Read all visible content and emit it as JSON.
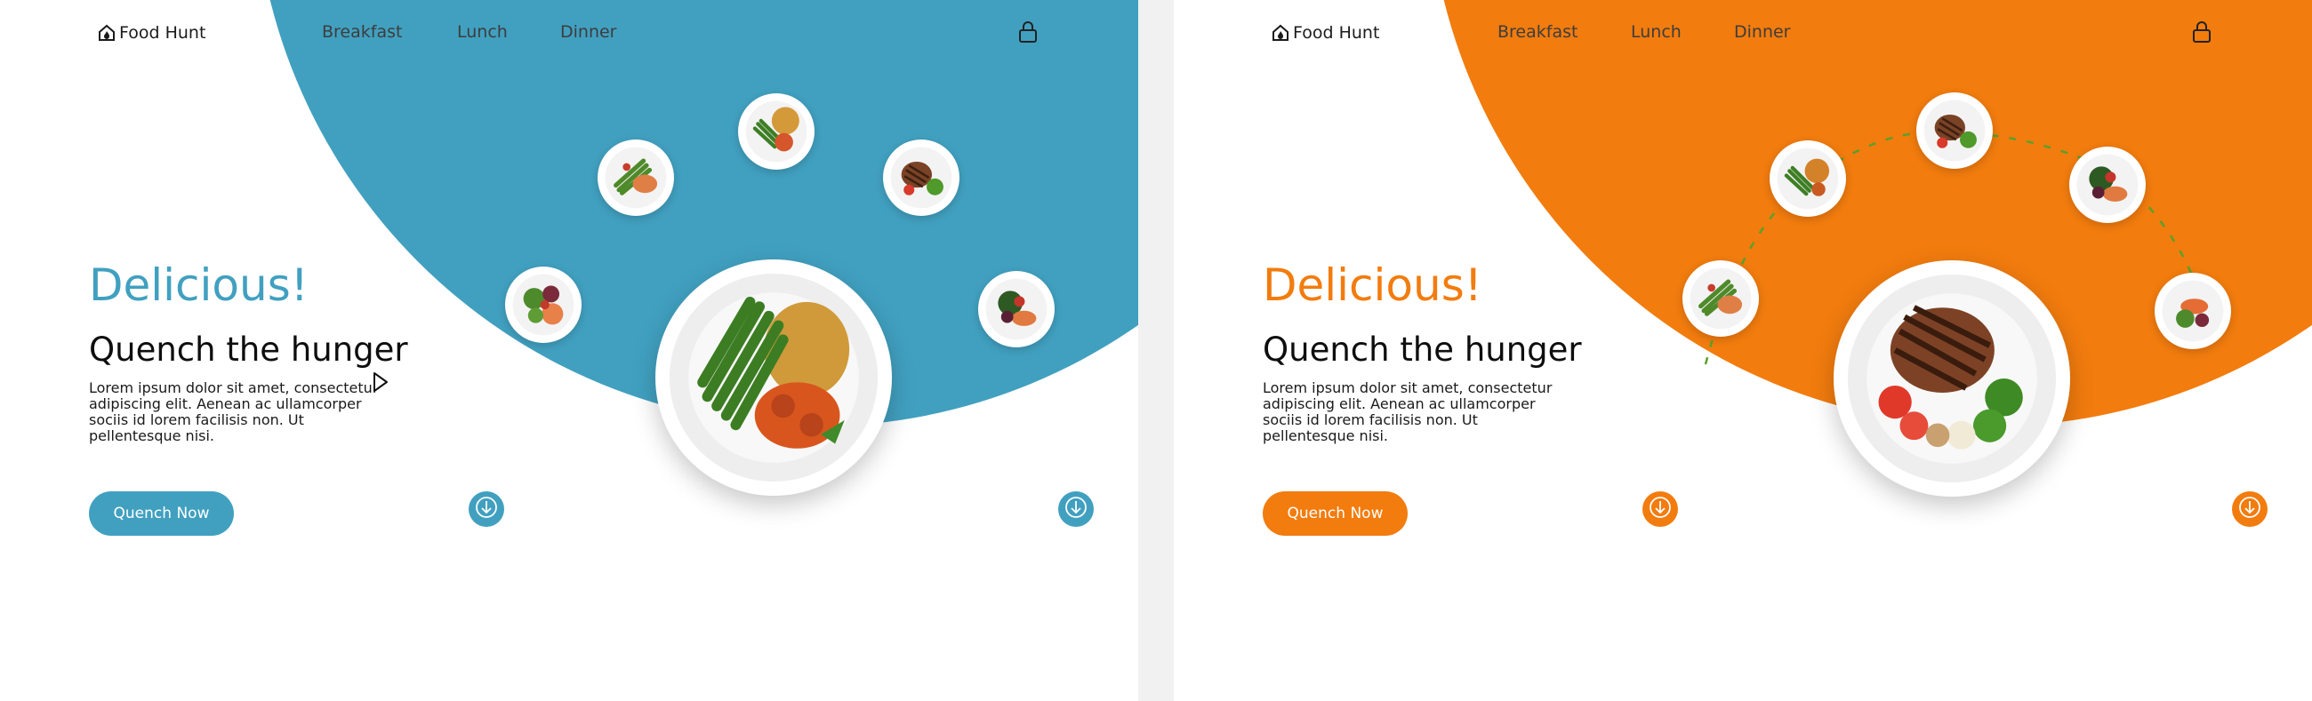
{
  "panels": [
    {
      "theme": "blue",
      "accent": "#41a0c0",
      "brand": {
        "name": "Food Hunt",
        "icon": "home-flame-icon"
      },
      "nav": [
        {
          "label": "Breakfast"
        },
        {
          "label": "Lunch"
        },
        {
          "label": "Dinner"
        }
      ],
      "lock_icon": "lock-icon",
      "hero": {
        "accent_text": "Delicious!",
        "title": "Quench the hunger",
        "body": "Lorem ipsum dolor sit amet, consectetur adipiscing elit. Aenean ac ullamcorper sociis id lorem facilisis non. Ut pellentesque nisi.",
        "cta": "Quench Now"
      },
      "featured_dish": "green beans, rice and glazed chicken",
      "carousel": [
        "salmon salad",
        "asparagus and salmon",
        "green beans and rice",
        "grilled steak",
        "salad with salmon"
      ],
      "scroll_icon": "arrow-down-icon",
      "cursor_icon": "pointer-cursor-icon"
    },
    {
      "theme": "orange",
      "accent": "#f27c0e",
      "brand": {
        "name": "Food Hunt",
        "icon": "home-flame-icon"
      },
      "nav": [
        {
          "label": "Breakfast"
        },
        {
          "label": "Lunch"
        },
        {
          "label": "Dinner"
        }
      ],
      "lock_icon": "lock-icon",
      "hero": {
        "accent_text": "Delicious!",
        "title": "Quench the hunger",
        "body": "Lorem ipsum dolor sit amet, consectetur adipiscing elit. Aenean ac ullamcorper sociis id lorem facilisis non. Ut pellentesque nisi.",
        "cta": "Quench Now"
      },
      "featured_dish": "grilled steak with tomatoes and broccoli",
      "carousel": [
        "asparagus and salmon",
        "green beans and chicken",
        "grilled steak",
        "salad with salmon",
        "salmon salad"
      ],
      "scroll_icon": "arrow-down-icon"
    }
  ]
}
